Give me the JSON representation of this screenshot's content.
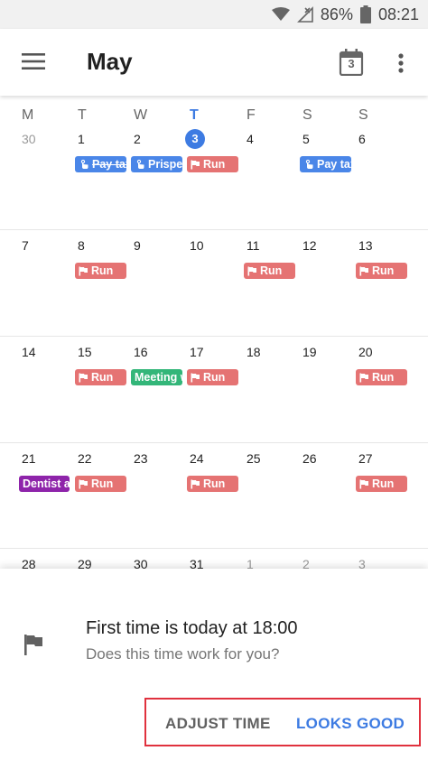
{
  "status_bar": {
    "battery": "86%",
    "time": "08:21",
    "icons": [
      "wifi-icon",
      "no-signal-icon",
      "battery-icon"
    ]
  },
  "app_bar": {
    "title": "May",
    "calendar_day": "3",
    "icons": [
      "menu-icon",
      "calendar-today-icon",
      "more-vert-icon"
    ]
  },
  "weekdays": [
    "M",
    "T",
    "W",
    "T",
    "F",
    "S",
    "S"
  ],
  "today_index": 3,
  "weeks": [
    {
      "days": [
        "30",
        "1",
        "2",
        "3",
        "4",
        "5",
        "6"
      ],
      "muted": [
        true,
        false,
        false,
        false,
        false,
        false,
        false
      ]
    },
    {
      "days": [
        "7",
        "8",
        "9",
        "10",
        "11",
        "12",
        "13"
      ],
      "muted": [
        false,
        false,
        false,
        false,
        false,
        false,
        false
      ]
    },
    {
      "days": [
        "14",
        "15",
        "16",
        "17",
        "18",
        "19",
        "20"
      ],
      "muted": [
        false,
        false,
        false,
        false,
        false,
        false,
        false
      ]
    },
    {
      "days": [
        "21",
        "22",
        "23",
        "24",
        "25",
        "26",
        "27"
      ],
      "muted": [
        false,
        false,
        false,
        false,
        false,
        false,
        false
      ]
    },
    {
      "days": [
        "28",
        "29",
        "30",
        "31",
        "1",
        "2",
        "3"
      ],
      "muted": [
        false,
        false,
        false,
        false,
        true,
        true,
        true
      ]
    }
  ],
  "events": [
    {
      "week": 0,
      "day": 1,
      "label": "Pay tax",
      "kind": "blue",
      "icon": "hand-icon",
      "strike": true
    },
    {
      "week": 0,
      "day": 2,
      "label": "Prispev",
      "kind": "blue",
      "icon": "hand-icon",
      "strike": false
    },
    {
      "week": 0,
      "day": 3,
      "label": "Run",
      "kind": "run",
      "icon": "flag-icon",
      "strike": false
    },
    {
      "week": 0,
      "day": 5,
      "label": "Pay tax",
      "kind": "blue",
      "icon": "hand-icon",
      "strike": false
    },
    {
      "week": 1,
      "day": 1,
      "label": "Run",
      "kind": "run",
      "icon": "flag-icon",
      "strike": false
    },
    {
      "week": 1,
      "day": 4,
      "label": "Run",
      "kind": "run",
      "icon": "flag-icon",
      "strike": false
    },
    {
      "week": 1,
      "day": 6,
      "label": "Run",
      "kind": "run",
      "icon": "flag-icon",
      "strike": false
    },
    {
      "week": 2,
      "day": 1,
      "label": "Run",
      "kind": "run",
      "icon": "flag-icon",
      "strike": false
    },
    {
      "week": 2,
      "day": 2,
      "label": "Meeting w",
      "kind": "green",
      "icon": "",
      "strike": false
    },
    {
      "week": 2,
      "day": 3,
      "label": "Run",
      "kind": "run",
      "icon": "flag-icon",
      "strike": false
    },
    {
      "week": 2,
      "day": 6,
      "label": "Run",
      "kind": "run",
      "icon": "flag-icon",
      "strike": false
    },
    {
      "week": 3,
      "day": 0,
      "label": "Dentist ap",
      "kind": "purple",
      "icon": "",
      "strike": false
    },
    {
      "week": 3,
      "day": 1,
      "label": "Run",
      "kind": "run",
      "icon": "flag-icon",
      "strike": false
    },
    {
      "week": 3,
      "day": 3,
      "label": "Run",
      "kind": "run",
      "icon": "flag-icon",
      "strike": false
    },
    {
      "week": 3,
      "day": 6,
      "label": "Run",
      "kind": "run",
      "icon": "flag-icon",
      "strike": false
    }
  ],
  "sheet": {
    "title": "First time is today at 18:00",
    "subtitle": "Does this time work for you?",
    "adjust_label": "ADJUST TIME",
    "good_label": "LOOKS GOOD"
  },
  "colors": {
    "accent": "#3d7be2",
    "run": "#e57373",
    "blue_event": "#4a86e8",
    "green_event": "#33b679",
    "purple_event": "#8e24aa",
    "highlight": "#e0313e"
  }
}
